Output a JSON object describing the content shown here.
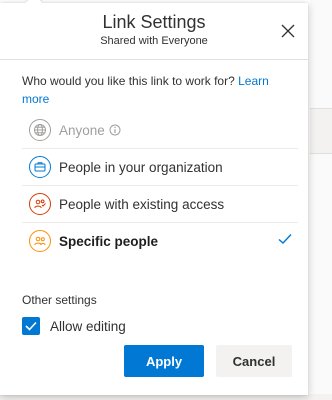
{
  "dialog": {
    "title": "Link Settings",
    "subtitle": "Shared with Everyone",
    "question_text": "Who would you like this link to work for?",
    "learn_more": "Learn more"
  },
  "options": [
    {
      "label": "Anyone",
      "icon": "globe-icon",
      "color": "#a19f9d",
      "disabled": true,
      "selected": false
    },
    {
      "label": "People in your organization",
      "icon": "organization-icon",
      "color": "#0078d4",
      "disabled": false,
      "selected": false
    },
    {
      "label": "People with existing access",
      "icon": "existing-access-icon",
      "color": "#d83b01",
      "disabled": false,
      "selected": false
    },
    {
      "label": "Specific people",
      "icon": "specific-people-icon",
      "color": "#ff8c00",
      "disabled": false,
      "selected": true
    }
  ],
  "other_settings": {
    "title": "Other settings",
    "allow_editing": {
      "label": "Allow editing",
      "checked": true
    }
  },
  "buttons": {
    "apply": "Apply",
    "cancel": "Cancel"
  },
  "colors": {
    "accent": "#0078d4"
  }
}
